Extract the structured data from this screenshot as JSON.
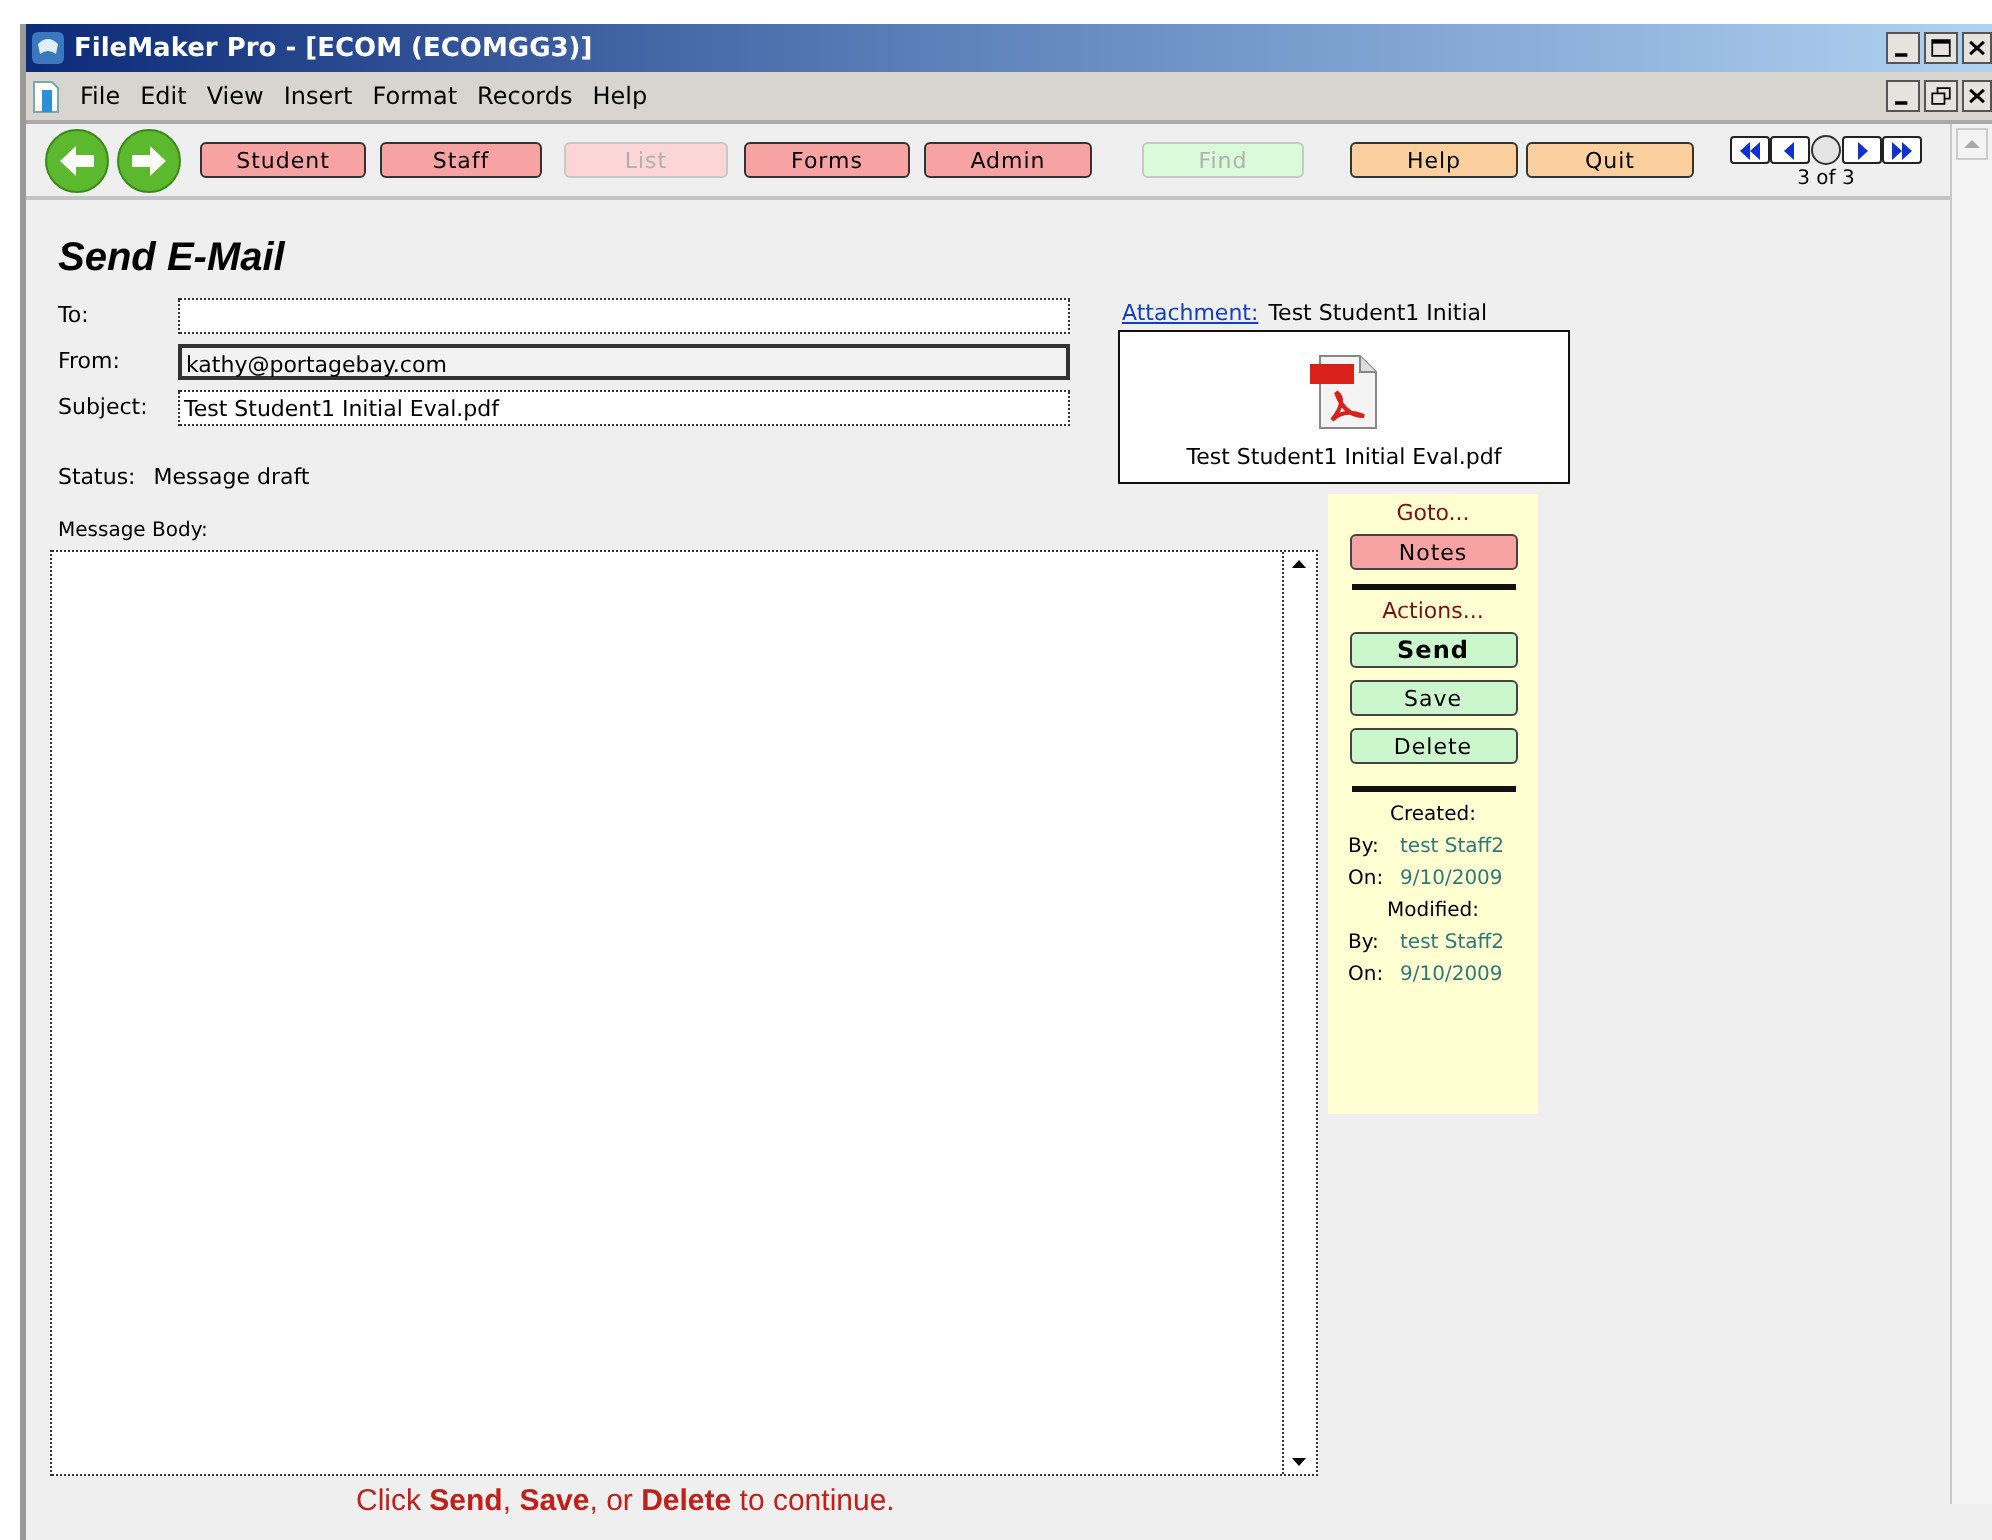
{
  "window": {
    "title": "FileMaker Pro - [ECOM (ECOMGG3)]"
  },
  "menu": [
    "File",
    "Edit",
    "View",
    "Insert",
    "Format",
    "Records",
    "Help"
  ],
  "toolbar": {
    "buttons": [
      {
        "label": "Student",
        "kind": "nav",
        "disabled": false
      },
      {
        "label": "Staff",
        "kind": "nav",
        "disabled": false
      },
      {
        "label": "List",
        "kind": "nav",
        "disabled": true
      },
      {
        "label": "Forms",
        "kind": "nav",
        "disabled": false
      },
      {
        "label": "Admin",
        "kind": "nav",
        "disabled": false
      },
      {
        "label": "Find",
        "kind": "action",
        "disabled": true
      },
      {
        "label": "Help",
        "kind": "util",
        "disabled": false
      },
      {
        "label": "Quit",
        "kind": "util",
        "disabled": false
      }
    ],
    "record_reading": "3 of 3"
  },
  "form": {
    "title": "Send E-Mail",
    "fields": [
      {
        "label": "To:",
        "kind": "dotted"
      },
      {
        "label": "From:",
        "value": "kathy@portagebay.com",
        "kind": "solid"
      },
      {
        "label": "Subject:",
        "value": "Test Student1 Initial Eval.pdf",
        "kind": "dotted"
      }
    ],
    "status": {
      "label": "Status:",
      "value": "Message draft"
    },
    "attachment": {
      "link": "Attachment:",
      "name": "Test Student1 Initial",
      "file": "Test Student1 Initial Eval.pdf"
    },
    "body_label": "Message Body:"
  },
  "side_panel": {
    "goto_label": "Goto...",
    "goto_buttons": [
      {
        "label": "Notes",
        "kind": "nav",
        "emphasis": false
      }
    ],
    "actions_label": "Actions...",
    "action_buttons": [
      {
        "label": "Send",
        "kind": "action",
        "emphasis": true
      },
      {
        "label": "Save",
        "kind": "action",
        "emphasis": false
      },
      {
        "label": "Delete",
        "kind": "action",
        "emphasis": false
      }
    ],
    "created": {
      "label": "Created:",
      "by_label": "By:",
      "by": "test Staff2",
      "on_label": "On:",
      "on": "9/10/2009"
    },
    "modified": {
      "label": "Modified:",
      "by_label": "By:",
      "by": "test Staff2",
      "on_label": "On:",
      "on": "9/10/2009"
    }
  },
  "footer": "Click **Send**, **Save**, or **Delete** to continue."
}
